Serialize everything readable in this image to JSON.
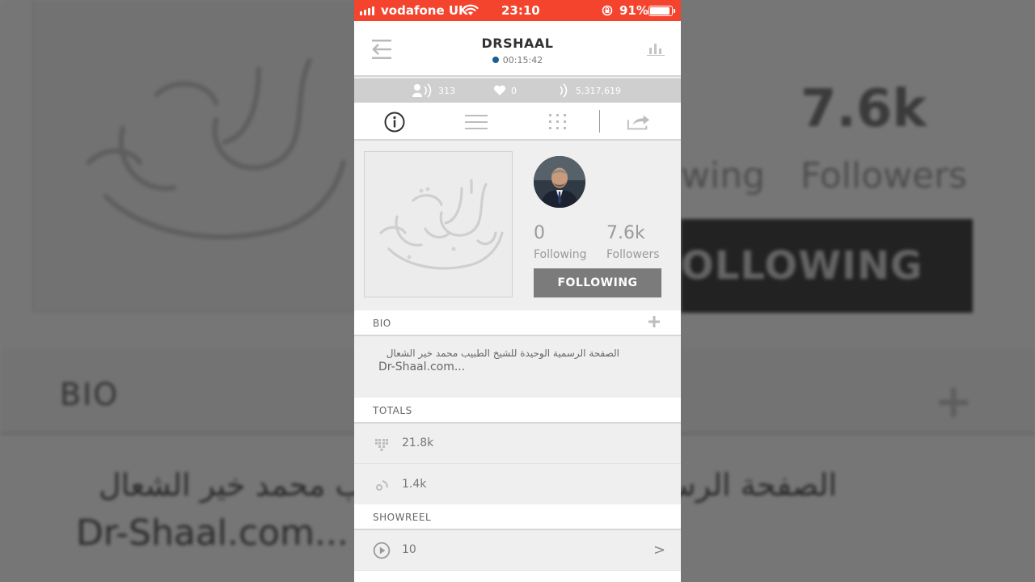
{
  "status_bar": {
    "carrier": "vodafone UK",
    "time": "23:10",
    "battery": "91%",
    "battery_level": 0.91
  },
  "header": {
    "title": "DRSHAAL",
    "live_duration": "00:15:42",
    "live_dot_color": "#1a5e96",
    "back_icon": "back-arrow-icon",
    "stats_icon": "bar-chart-icon"
  },
  "counts": {
    "viewers": "313",
    "hearts": "0",
    "broadcast_views": "5,317,619"
  },
  "tabs": [
    {
      "name": "info",
      "icon": "info-icon"
    },
    {
      "name": "list",
      "icon": "list-icon"
    },
    {
      "name": "grid",
      "icon": "grid-icon"
    },
    {
      "name": "share",
      "icon": "share-icon"
    }
  ],
  "profile": {
    "following_count": "0",
    "following_label": "Following",
    "followers_count": "7.6k",
    "followers_label": "Followers",
    "follow_button": "FOLLOWING"
  },
  "bio": {
    "heading": "BIO",
    "text": "الصفحة الرسمية الوحيدة للشيخ الطبيب محمد خير الشعال",
    "url": "Dr-Shaal.com..."
  },
  "totals": {
    "heading": "TOTALS",
    "hearts_total": "21.8k",
    "broadcasts_total": "1.4k"
  },
  "showreel": {
    "heading": "SHOWREEL",
    "count": "10"
  },
  "colors": {
    "status_bar": "#f4442e",
    "follow_button": "#7b7b7b",
    "background": "#efefef"
  }
}
